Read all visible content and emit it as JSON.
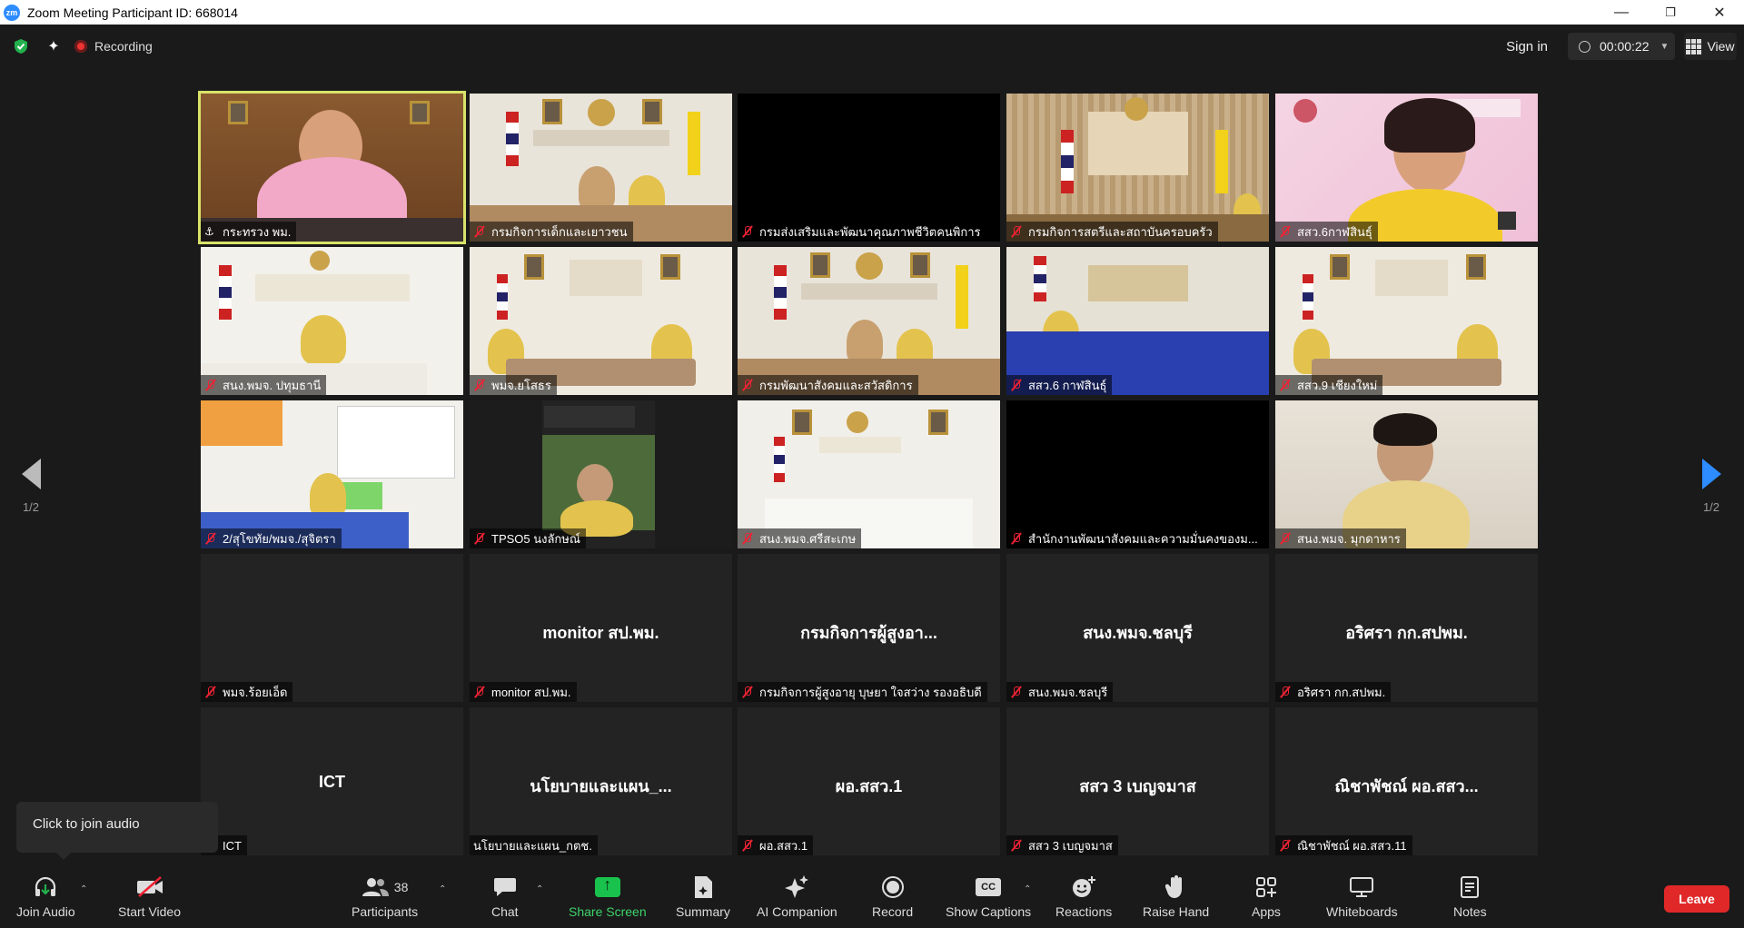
{
  "window": {
    "title": "Zoom Meeting Participant ID: 668014",
    "app_icon_label": "zm",
    "controls": [
      "minimize",
      "restore",
      "close"
    ]
  },
  "topbar": {
    "recording_label": "Recording",
    "sign_in": "Sign in",
    "timer": "00:00:22",
    "view_label": "View"
  },
  "pagination": {
    "left": "1/2",
    "right": "1/2"
  },
  "tooltip": "Click to join audio",
  "tiles": [
    {
      "name": "กระทรวง พม.",
      "kind": "video",
      "scene": "pink",
      "pinned": true,
      "active": true
    },
    {
      "name": "กรมกิจการเด็กและเยาวชน",
      "kind": "video",
      "scene": "office-flag",
      "muted": true
    },
    {
      "name": "กรมส่งเสริมและพัฒนาคุณภาพชีวิตคนพิการ",
      "kind": "black",
      "muted": true
    },
    {
      "name": "กรมกิจการสตรีและสถาบันครอบครัว",
      "kind": "video",
      "scene": "curtain",
      "muted": true
    },
    {
      "name": "สสว.6กาฬสินธุ์",
      "kind": "video",
      "scene": "poster",
      "muted": true
    },
    {
      "name": "สนง.พมจ. ปทุมธานี",
      "kind": "video",
      "scene": "office-sign",
      "muted": true
    },
    {
      "name": "พมจ.ยโสธร",
      "kind": "video",
      "scene": "meeting",
      "muted": true
    },
    {
      "name": "กรมพัฒนาสังคมและสวัสดิการ",
      "kind": "video",
      "scene": "office-flag",
      "muted": true
    },
    {
      "name": "สสว.6 กาฬสินธุ์",
      "kind": "video",
      "scene": "blue-table",
      "muted": true
    },
    {
      "name": "สสว.9 เชียงใหม่",
      "kind": "video",
      "scene": "meeting",
      "muted": true
    },
    {
      "name": "2/สุโขทัย/พมจ./สุจิตรา",
      "kind": "video",
      "scene": "green-office",
      "muted": true
    },
    {
      "name": "TPSO5 นงลักษณ์",
      "kind": "video",
      "scene": "small-portrait",
      "muted": true
    },
    {
      "name": "สนง.พมจ.ศรีสะเกษ",
      "kind": "video",
      "scene": "empty-room",
      "muted": true
    },
    {
      "name": "สำนักงานพัฒนาสังคมและความมั่นคงของม...",
      "kind": "black",
      "muted": true
    },
    {
      "name": "สนง.พมจ. มุกดาหาร",
      "kind": "video",
      "scene": "woman",
      "muted": true
    },
    {
      "name": "พมจ.ร้อยเอ็ด",
      "kind": "name",
      "center": "",
      "muted": true
    },
    {
      "name": "monitor สป.พม.",
      "kind": "name",
      "center": "monitor สป.พม.",
      "muted": true
    },
    {
      "name": "กรมกิจการผู้สูงอายุ บุษยา ใจสว่าง รองอธิบดี",
      "kind": "name",
      "center": "กรมกิจการผู้สูงอา...",
      "muted": true
    },
    {
      "name": "สนง.พมจ.ชลบุรี",
      "kind": "name",
      "center": "สนง.พมจ.ชลบุรี",
      "muted": true
    },
    {
      "name": "อริศรา กก.สปพม.",
      "kind": "name",
      "center": "อริศรา กก.สปพม.",
      "muted": true
    },
    {
      "name": "ICT",
      "kind": "name",
      "center": "ICT",
      "muted": true
    },
    {
      "name": "นโยบายและแผน_กตช.",
      "kind": "name",
      "center": "นโยบายและแผน_...",
      "muted": false
    },
    {
      "name": "ผอ.สสว.1",
      "kind": "name",
      "center": "ผอ.สสว.1",
      "muted": true
    },
    {
      "name": "สสว 3 เบญจมาส",
      "kind": "name",
      "center": "สสว 3 เบญจมาส",
      "muted": true
    },
    {
      "name": "ณิชาพัชณ์ ผอ.สสว.11",
      "kind": "name",
      "center": "ณิชาพัชณ์ ผอ.สสว...",
      "muted": true
    }
  ],
  "toolbar": {
    "join_audio": "Join Audio",
    "start_video": "Start Video",
    "participants": "Participants",
    "participants_count": "38",
    "chat": "Chat",
    "share_screen": "Share Screen",
    "summary": "Summary",
    "ai_companion": "AI Companion",
    "record": "Record",
    "show_captions": "Show Captions",
    "captions_icon_text": "CC",
    "reactions": "Reactions",
    "raise_hand": "Raise Hand",
    "apps": "Apps",
    "whiteboards": "Whiteboards",
    "notes": "Notes",
    "leave": "Leave"
  },
  "colors": {
    "active_border": "#d8e36a",
    "share_green": "#19c24d",
    "leave_red": "#e02828",
    "nav_arrow": "#2d8cff"
  }
}
